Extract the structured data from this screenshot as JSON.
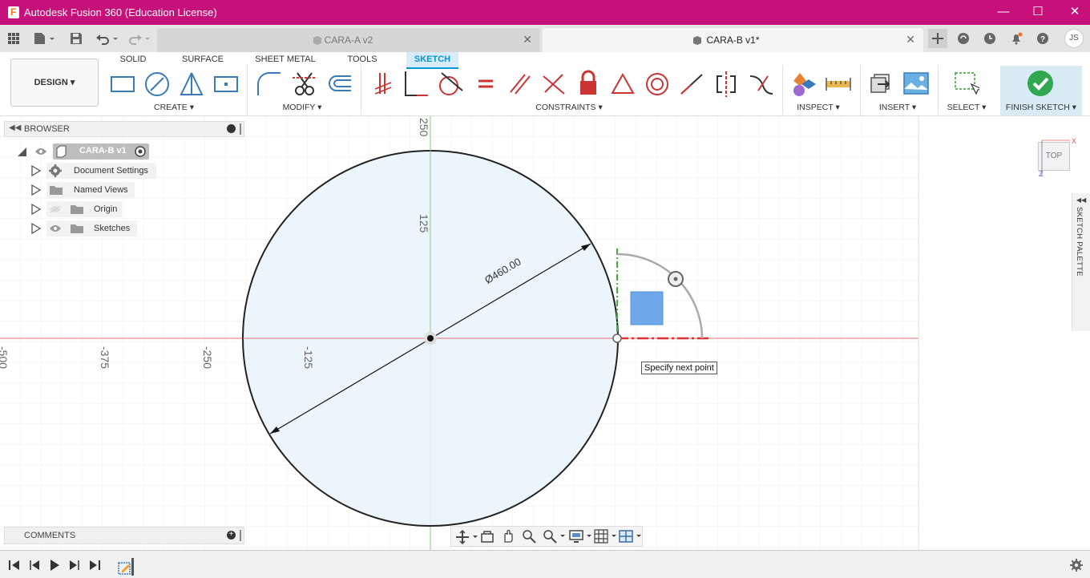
{
  "window": {
    "title": "Autodesk Fusion 360 (Education License)"
  },
  "tabs": [
    {
      "label": "CARA-A v2",
      "active": false
    },
    {
      "label": "CARA-B v1*",
      "active": true
    }
  ],
  "user": {
    "initials": "JS"
  },
  "workspace": {
    "label": "DESIGN"
  },
  "ribbon_tabs": [
    "SOLID",
    "SURFACE",
    "SHEET METAL",
    "TOOLS",
    "SKETCH"
  ],
  "groups": {
    "create": "CREATE",
    "modify": "MODIFY",
    "constraints": "CONSTRAINTS",
    "inspect": "INSPECT",
    "insert": "INSERT",
    "select": "SELECT",
    "finish": "FINISH SKETCH"
  },
  "browser": {
    "title": "BROWSER",
    "root": "CARA-B v1",
    "items": [
      "Document Settings",
      "Named Views",
      "Origin",
      "Sketches"
    ]
  },
  "comments": {
    "title": "COMMENTS"
  },
  "sketch_palette": {
    "label": "SKETCH PALETTE"
  },
  "viewcube": {
    "face": "TOP",
    "x_axis": "X",
    "z_axis": "Z"
  },
  "canvas": {
    "tooltip": "Specify next point",
    "dimension": "Ø460.00",
    "ruler_horizontal": [
      "-500",
      "-375",
      "-250",
      "-125"
    ],
    "ruler_vertical": [
      "250",
      "125"
    ]
  },
  "colors": {
    "titlebar": "#c6117a",
    "accent": "#0696d7",
    "finish_ok": "#2fa84f"
  }
}
